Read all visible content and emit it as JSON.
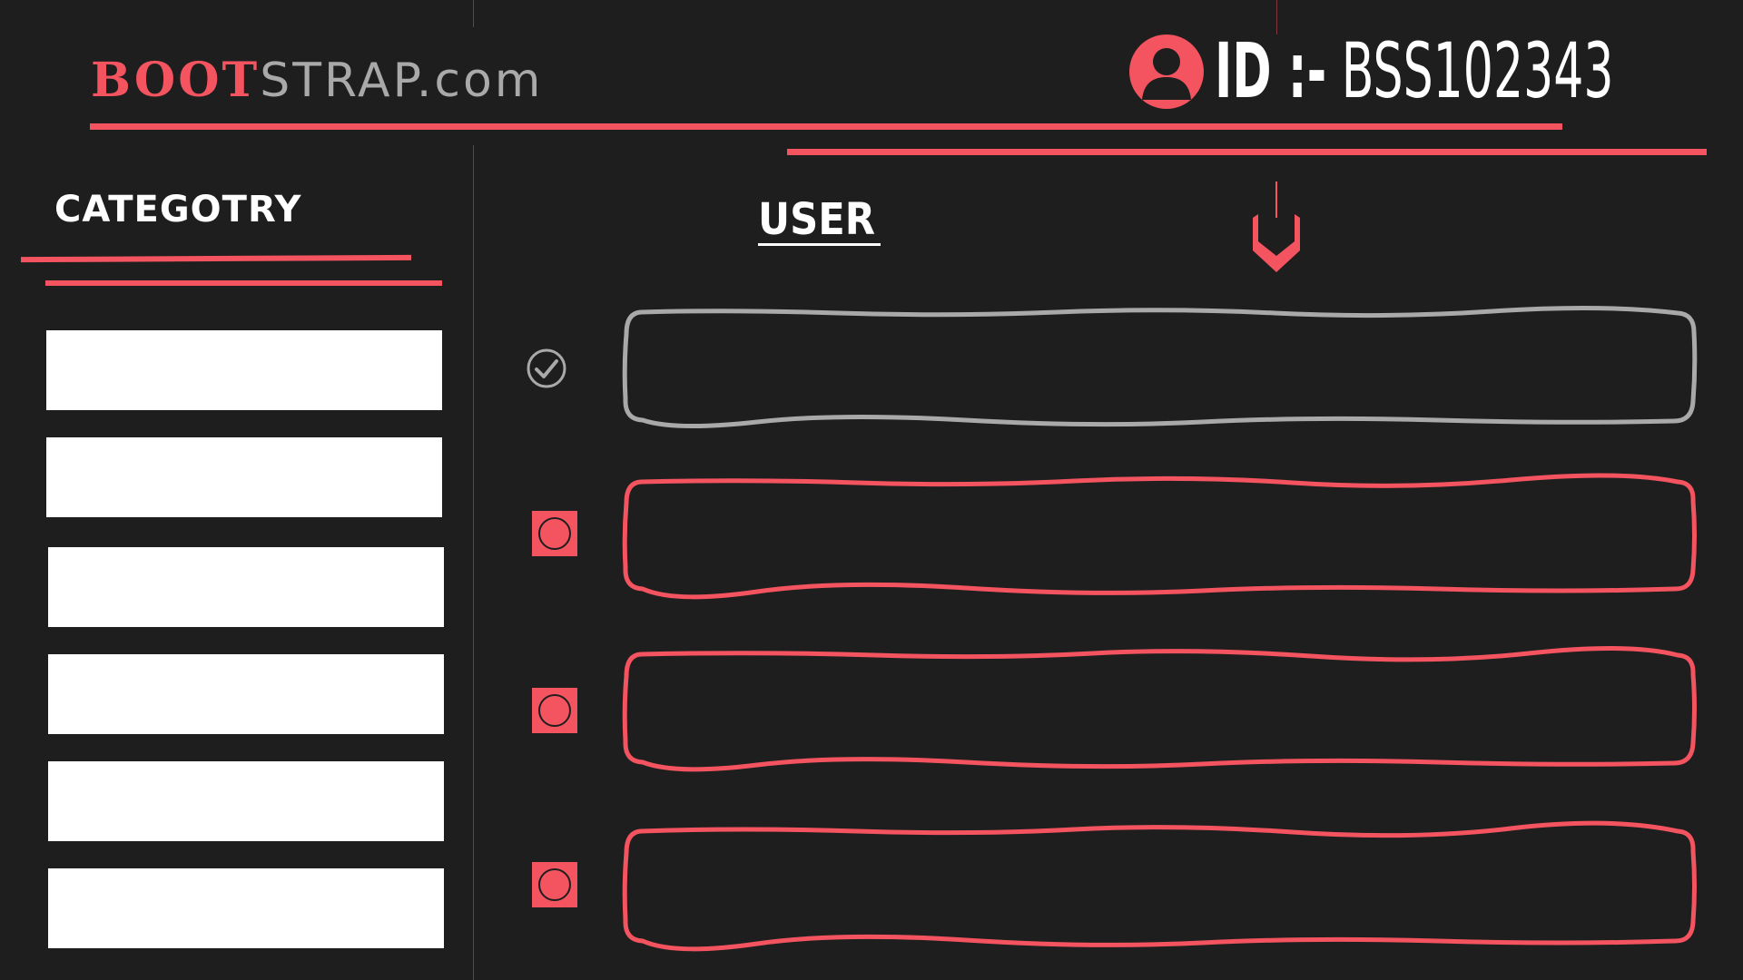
{
  "brand": {
    "part1": "BOOT",
    "part2": "STRAP.com"
  },
  "header": {
    "id_label": "ID :-",
    "id_value": "BSS102343",
    "avatar_icon": "user-avatar-icon"
  },
  "sidebar": {
    "title": "CATEGOTRY",
    "items": [
      "",
      "",
      "",
      "",
      "",
      ""
    ]
  },
  "main": {
    "title": "USER",
    "rows": [
      {
        "state": "selected",
        "icon": "check-circle-icon",
        "value": ""
      },
      {
        "state": "unselected",
        "icon": "radio-icon",
        "value": ""
      },
      {
        "state": "unselected",
        "icon": "radio-icon",
        "value": ""
      },
      {
        "state": "unselected",
        "icon": "radio-icon",
        "value": ""
      }
    ]
  },
  "colors": {
    "accent": "#f3545f",
    "background": "#1f1e1f",
    "muted": "#a9a9a9",
    "text": "#ffffff"
  }
}
